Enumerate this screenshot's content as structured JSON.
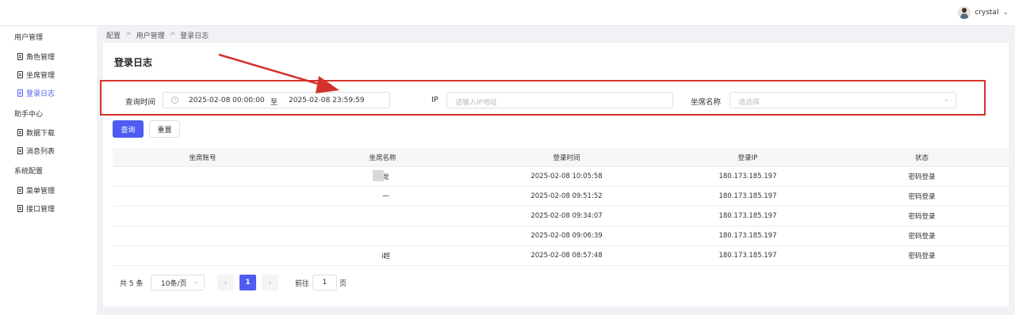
{
  "header": {
    "username": "crystal",
    "dropdown_icon": "chevron-down-icon"
  },
  "sidebar": {
    "groups": [
      {
        "label": "用户管理",
        "items": [
          {
            "label": "角色管理"
          },
          {
            "label": "坐席管理"
          },
          {
            "label": "登录日志",
            "active": true
          }
        ]
      },
      {
        "label": "助手中心",
        "items": [
          {
            "label": "数据下载"
          },
          {
            "label": "消息列表"
          }
        ]
      },
      {
        "label": "系统配置",
        "items": [
          {
            "label": "菜单管理"
          },
          {
            "label": "接口管理"
          }
        ]
      }
    ]
  },
  "breadcrumb": [
    "配置",
    "用户管理",
    "登录日志"
  ],
  "page": {
    "title": "登录日志"
  },
  "filters": {
    "time_label": "查询时间",
    "start": "2025-02-08 00:00:00",
    "range_sep": "至",
    "end": "2025-02-08 23:59:59",
    "ip_label": "IP",
    "ip_placeholder": "请输入IP地址",
    "seat_label": "坐席名称",
    "seat_placeholder": "请选择"
  },
  "buttons": {
    "query": "查询",
    "reset": "重置"
  },
  "table": {
    "columns": [
      "坐席账号",
      "坐席名称",
      "登录时间",
      "登录IP",
      "状态"
    ],
    "rows": [
      [
        "",
        "龙",
        "2025-02-08 10:05:58",
        "180.173.185.197",
        "密码登录"
      ],
      [
        "",
        "一",
        "2025-02-08 09:51:52",
        "180.173.185.197",
        "密码登录"
      ],
      [
        "",
        "",
        "2025-02-08 09:34:07",
        "180.173.185.197",
        "密码登录"
      ],
      [
        "",
        "",
        "2025-02-08 09:06:39",
        "180.173.185.197",
        "密码登录"
      ],
      [
        "",
        "i超",
        "2025-02-08 08:57:48",
        "180.173.185.197",
        "密码登录"
      ]
    ]
  },
  "pagination": {
    "total": "共 5 条",
    "page_size": "10条/页",
    "current_page": "1",
    "goto_label": "前往",
    "goto_value": "1",
    "page_suffix": "页"
  },
  "colors": {
    "accent": "#4f5bf1",
    "annotation": "#d3322b"
  }
}
